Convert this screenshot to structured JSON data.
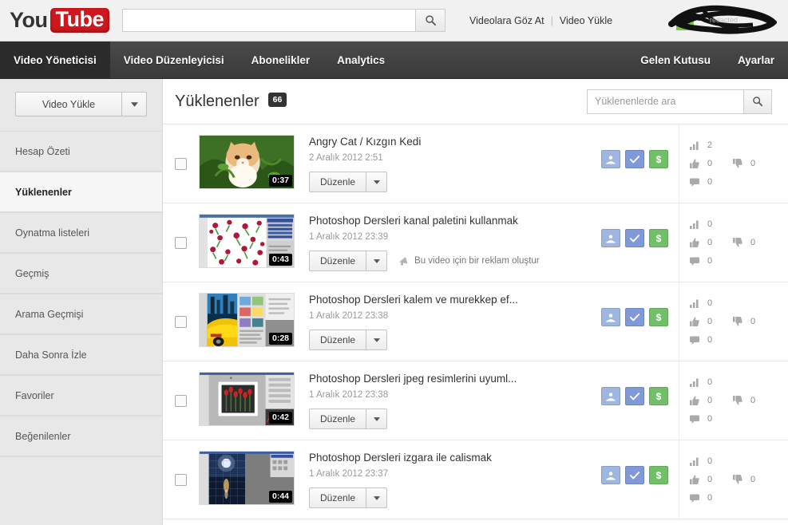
{
  "masthead": {
    "logo_you": "You",
    "logo_tube": "Tube",
    "search_value": "",
    "search_placeholder": "",
    "search_icon": "search-icon",
    "links": [
      {
        "label": "Videolara Göz At"
      },
      {
        "label": "Video Yükle"
      }
    ],
    "separator": "|",
    "account_name_redacted": ""
  },
  "navbar": {
    "items": [
      {
        "label": "Video Yöneticisi",
        "active": true
      },
      {
        "label": "Video Düzenleyicisi",
        "active": false
      },
      {
        "label": "Abonelikler",
        "active": false
      },
      {
        "label": "Analytics",
        "active": false
      }
    ],
    "right_items": [
      {
        "label": "Gelen Kutusu"
      },
      {
        "label": "Ayarlar"
      }
    ]
  },
  "sidebar": {
    "upload_button": "Video Yükle",
    "upload_dropdown_icon": "chevron-down-icon",
    "items": [
      {
        "label": "Hesap Özeti",
        "active": false
      },
      {
        "label": "Yüklenenler",
        "active": true
      },
      {
        "label": "Oynatma listeleri",
        "active": false
      },
      {
        "label": "Geçmiş",
        "active": false
      },
      {
        "label": "Arama Geçmişi",
        "active": false
      },
      {
        "label": "Daha Sonra İzle",
        "active": false
      },
      {
        "label": "Favoriler",
        "active": false
      },
      {
        "label": "Beğenilenler",
        "active": false
      }
    ]
  },
  "content": {
    "title": "Yüklenenler",
    "count": "66",
    "search_placeholder": "Yüklenenlerde ara",
    "search_value": "",
    "search_icon": "search-icon",
    "edit_label": "Düzenle",
    "edit_dropdown_icon": "chevron-down-icon",
    "promo_label": "Bu video için bir reklam oluştur",
    "promo_icon": "megaphone-icon",
    "btn_privacy_icon": "public-privacy-icon",
    "btn_status_icon": "check-icon",
    "btn_money_icon": "dollar-icon",
    "btn_money_label": "$",
    "stat_views_icon": "bar-chart-icon",
    "stat_likes_icon": "thumbs-up-icon",
    "stat_dislikes_icon": "thumbs-down-icon",
    "stat_comments_icon": "comment-icon"
  },
  "videos": [
    {
      "title": "Angry Cat / Kızgın Kedi",
      "date": "2 Aralık 2012 2:51",
      "duration": "0:37",
      "thumb": "cat",
      "views": "2",
      "likes": "0",
      "dislikes": "0",
      "comments": "0",
      "has_promo": false,
      "checked": false
    },
    {
      "title": "Photoshop Dersleri kanal paletini kullanmak",
      "date": "1 Aralık 2012 23:39",
      "duration": "0:43",
      "thumb": "roses",
      "views": "0",
      "likes": "0",
      "dislikes": "0",
      "comments": "0",
      "has_promo": true,
      "checked": false
    },
    {
      "title": "Photoshop Dersleri kalem ve murekkep ef...",
      "date": "1 Aralık 2012 23:38",
      "duration": "0:28",
      "thumb": "car",
      "views": "0",
      "likes": "0",
      "dislikes": "0",
      "comments": "0",
      "has_promo": false,
      "checked": false
    },
    {
      "title": "Photoshop Dersleri jpeg resimlerini uyuml...",
      "date": "1 Aralık 2012 23:38",
      "duration": "0:42",
      "thumb": "tulips",
      "views": "0",
      "likes": "0",
      "dislikes": "0",
      "comments": "0",
      "has_promo": false,
      "checked": false
    },
    {
      "title": "Photoshop Dersleri izgara ile calismak",
      "date": "1 Aralık 2012 23:37",
      "duration": "0:44",
      "thumb": "night",
      "views": "0",
      "likes": "0",
      "dislikes": "0",
      "comments": "0",
      "has_promo": false,
      "checked": false
    }
  ],
  "colors": {
    "brand_red": "#cc181e",
    "nav_dark": "#3a3a3a",
    "nav_active": "#2b2b2b",
    "sidebar_bg": "#e8e8e8",
    "badge_bg": "#333333",
    "btn_privacy": "#9fb7e0",
    "btn_status": "#8099d8",
    "btn_money": "#72bf6a"
  }
}
